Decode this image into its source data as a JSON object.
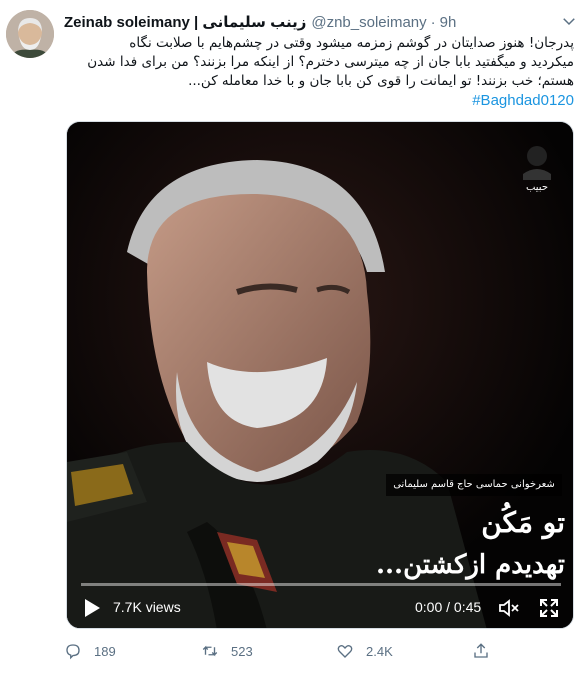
{
  "tweet": {
    "display_name": "Zeinab soleimany | زینب سلیمانی",
    "handle": "@znb_soleimany",
    "separator": "·",
    "time": "9h",
    "text_lines": [
      "پدرجان! هنوز صدایتان در گوشم زمزمه میشود وقتی در چشم‌هایم با صلابت نگاه",
      "میکردید و میگفتید بابا جان از چه میترسی دخترم؟ از اینکه مرا بزنند؟ من برای فدا شدن",
      "هستم؛ خب بزنند! تو ایمانت را قوی کن بابا جان و با خدا معامله کن..."
    ],
    "hashtag": "#Baghdad0120"
  },
  "media": {
    "caption_tag": "شعرخوانی حماسی حاج قاسم سلیمانی",
    "overlay_line1": "تو مَکُن",
    "overlay_line2": "تهدیدم ازکشتن...",
    "channel_logo_text": "حبیب",
    "views": "7.7K views",
    "timecode": "0:00 / 0:45",
    "progress": 0.0
  },
  "actions": {
    "reply_count": "189",
    "retweet_count": "523",
    "like_count": "2.4K"
  },
  "icons": {
    "caret": "chevron-down-icon",
    "play": "play-icon",
    "volume": "volume-muted-icon",
    "fullscreen": "fullscreen-icon",
    "reply": "reply-icon",
    "retweet": "retweet-icon",
    "like": "heart-icon",
    "share": "share-icon"
  },
  "colors": {
    "link": "#1b95e0",
    "secondary_text": "#5b7083",
    "primary_text": "#0f1419"
  }
}
